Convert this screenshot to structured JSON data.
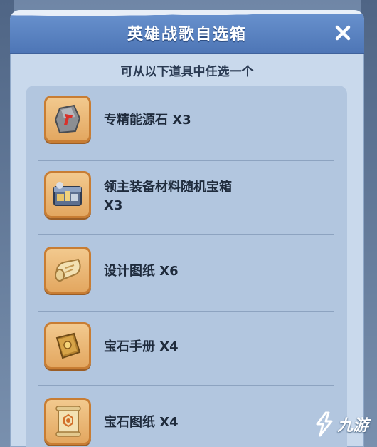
{
  "dialog": {
    "title": "英雄战歌自选箱",
    "subtitle": "可从以下道具中任选一个"
  },
  "items": [
    {
      "label": "专精能源石 X3",
      "icon": "energy-stone-icon"
    },
    {
      "label_line1": "领主装备材料随机宝箱",
      "label_line2": "X3",
      "icon": "treasure-chest-icon"
    },
    {
      "label": "设计图纸 X6",
      "icon": "blueprint-scroll-icon"
    },
    {
      "label": "宝石手册 X4",
      "icon": "gem-manual-icon"
    },
    {
      "label": "宝石图纸 X4",
      "icon": "gem-blueprint-icon"
    }
  ],
  "watermark": {
    "text": "九游"
  },
  "colors": {
    "title_bar": "#5a83c3",
    "panel": "#c9d9ec",
    "list_bg": "#b2c6df",
    "icon_frame": "#e3a760"
  }
}
